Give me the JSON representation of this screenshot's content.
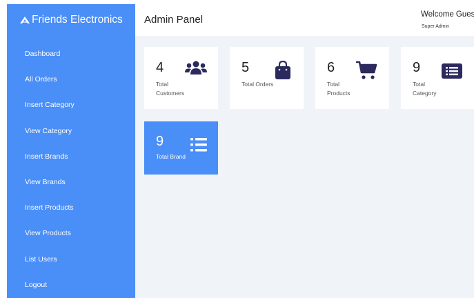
{
  "sidebar": {
    "brand": "Friends Electronics",
    "items": [
      {
        "label": "Dashboard"
      },
      {
        "label": "All Orders"
      },
      {
        "label": "Insert Category"
      },
      {
        "label": "View Category"
      },
      {
        "label": "Insert Brands"
      },
      {
        "label": "View Brands"
      },
      {
        "label": "Insert Products"
      },
      {
        "label": "View Products"
      },
      {
        "label": "List Users"
      },
      {
        "label": "Logout"
      }
    ]
  },
  "header": {
    "title": "Admin Panel",
    "welcome": "Welcome Guest",
    "role": "Super Admin"
  },
  "stats": [
    {
      "value": "4",
      "label": "Total Customers",
      "icon": "users-icon"
    },
    {
      "value": "5",
      "label": "Total Orders",
      "icon": "shopping-bag-icon"
    },
    {
      "value": "6",
      "label": "Total Products",
      "icon": "shopping-cart-icon"
    },
    {
      "value": "9",
      "label": "Total Category",
      "icon": "list-alt-icon"
    },
    {
      "value": "9",
      "label": "Total Brand",
      "icon": "list-icon"
    }
  ],
  "colors": {
    "sidebar": "#4a8ef7",
    "highlight_card": "#4a8ef7",
    "icon": "#2c2a5c",
    "background": "#f0f4f9"
  }
}
